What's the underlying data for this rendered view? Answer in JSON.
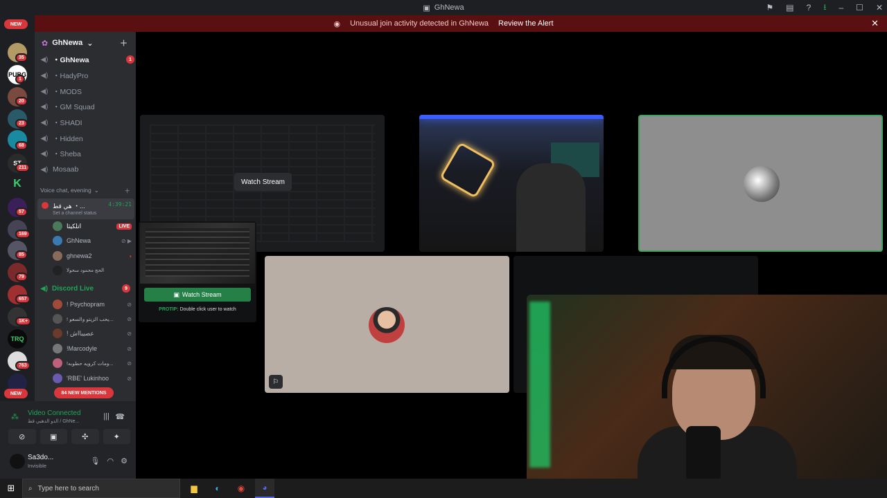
{
  "window": {
    "title": "GhNewa"
  },
  "alert": {
    "message": "Unusual join activity detected in GhNewa",
    "action": "Review the Alert"
  },
  "guilds": {
    "new_top": "NEW",
    "new_bottom": "NEW",
    "badges": [
      "35",
      "1",
      "20",
      "23",
      "68",
      "211",
      "57",
      "169",
      "85",
      "79",
      "657",
      "1K+",
      "763"
    ]
  },
  "server": {
    "name": "GhNewa"
  },
  "channels": [
    {
      "name": "・GhNewa",
      "count": "1"
    },
    {
      "name": "・HadyPro"
    },
    {
      "name": "・MODS"
    },
    {
      "name": "・GM Squad"
    },
    {
      "name": "・SHADI"
    },
    {
      "name": "・Hidden"
    },
    {
      "name": "・Sheba"
    },
    {
      "name": "Mosaab"
    }
  ],
  "voice_category": "Voice chat, evening",
  "active_vc": {
    "name": "هي قط ・...",
    "timer": "4:39:21",
    "status": "Set a channel status"
  },
  "vc_users": [
    {
      "name": "اتلكيثا",
      "badge": "LIVE"
    },
    {
      "name": "GhNewa"
    },
    {
      "name": "ghnewa2"
    },
    {
      "name": "الحج محمود سحولا"
    }
  ],
  "discord_live": {
    "name": "Discord Live",
    "count": "9"
  },
  "live_users": [
    {
      "name": "! Psychopram"
    },
    {
      "name": "! يحب الزيتو والسعو..."
    },
    {
      "name": "! عصيبااش"
    },
    {
      "name": "!Marcodyle"
    },
    {
      "name": "!ومات كرويه حطوبه..."
    },
    {
      "name": "'RBE' Lukinhoo"
    }
  ],
  "mentions": "84 NEW MENTIONS",
  "voice_conn": {
    "title": "Video Connected",
    "sub": "الدو الدهبي قط / GhNe..."
  },
  "me": {
    "name": "Sa3do...",
    "status": "Invisible"
  },
  "stage": {
    "watch_label": "Watch Stream",
    "popup_btn": "Watch Stream",
    "protip_label": "PROTIP:",
    "protip_text": "Double click user to watch"
  },
  "taskbar": {
    "search_placeholder": "Type here to search"
  },
  "colors": {
    "accent": "#5865f2",
    "green": "#23a559",
    "red": "#da373c",
    "alert_bg": "#5a1010"
  }
}
